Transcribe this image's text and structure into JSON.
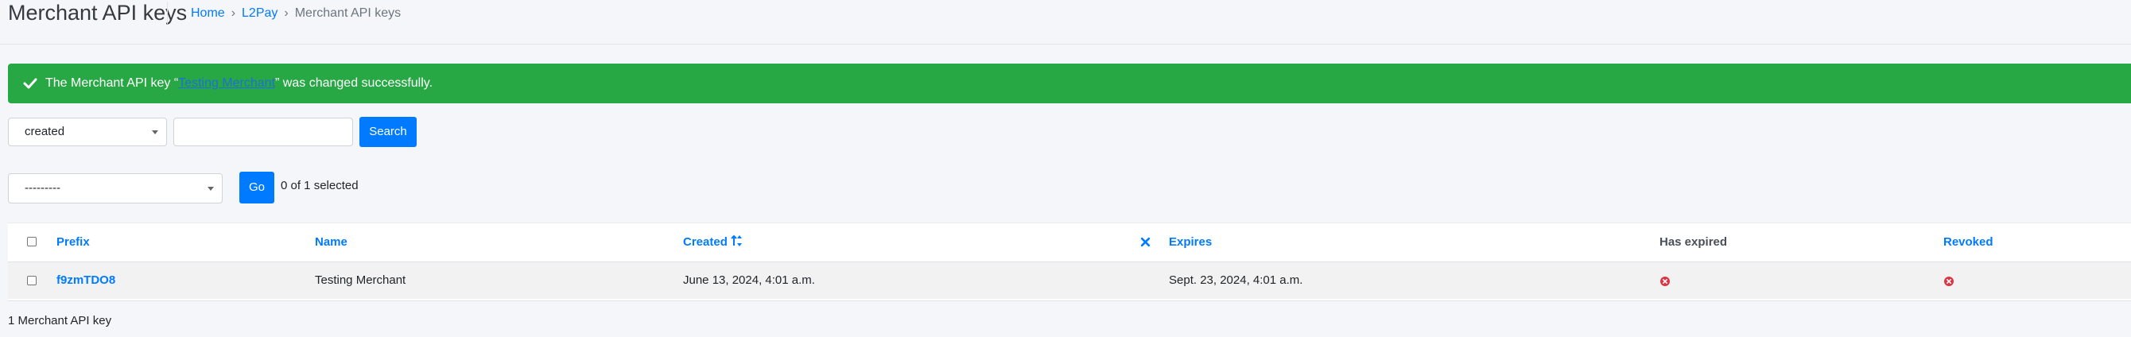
{
  "page": {
    "title": "Merchant API keys",
    "breadcrumb": [
      "Home",
      "L2Pay",
      "Merchant API keys"
    ],
    "breadcrumb_sep": "›"
  },
  "alert": {
    "prefix": "The Merchant API key “",
    "link": "Testing Merchant",
    "suffix": "” was changed successfully.",
    "icon": "check-icon",
    "color": "#28a745"
  },
  "search": {
    "field_select": "created",
    "query_value": "",
    "button": "Search"
  },
  "actions": {
    "select": "---------",
    "button": "Go",
    "selected_count": "0 of 1 selected"
  },
  "table": {
    "columns": {
      "prefix": "Prefix",
      "name": "Name",
      "created": "Created",
      "created_sort_icon": "sort-asc-desc-icon",
      "clear_sort_icon": "close-icon",
      "expires": "Expires",
      "has_expired": "Has expired",
      "revoked": "Revoked"
    },
    "rows": [
      {
        "prefix": "f9zmTDO8",
        "name": "Testing Merchant",
        "created": "June 13, 2024, 4:01 a.m.",
        "expires": "Sept. 23, 2024, 4:01 a.m.",
        "has_expired": "false-icon",
        "revoked": "false-icon"
      }
    ]
  },
  "footer": {
    "count": "1 Merchant API key"
  },
  "colors": {
    "primary": "#007bff",
    "success": "#28a745",
    "danger": "#dc3545"
  }
}
